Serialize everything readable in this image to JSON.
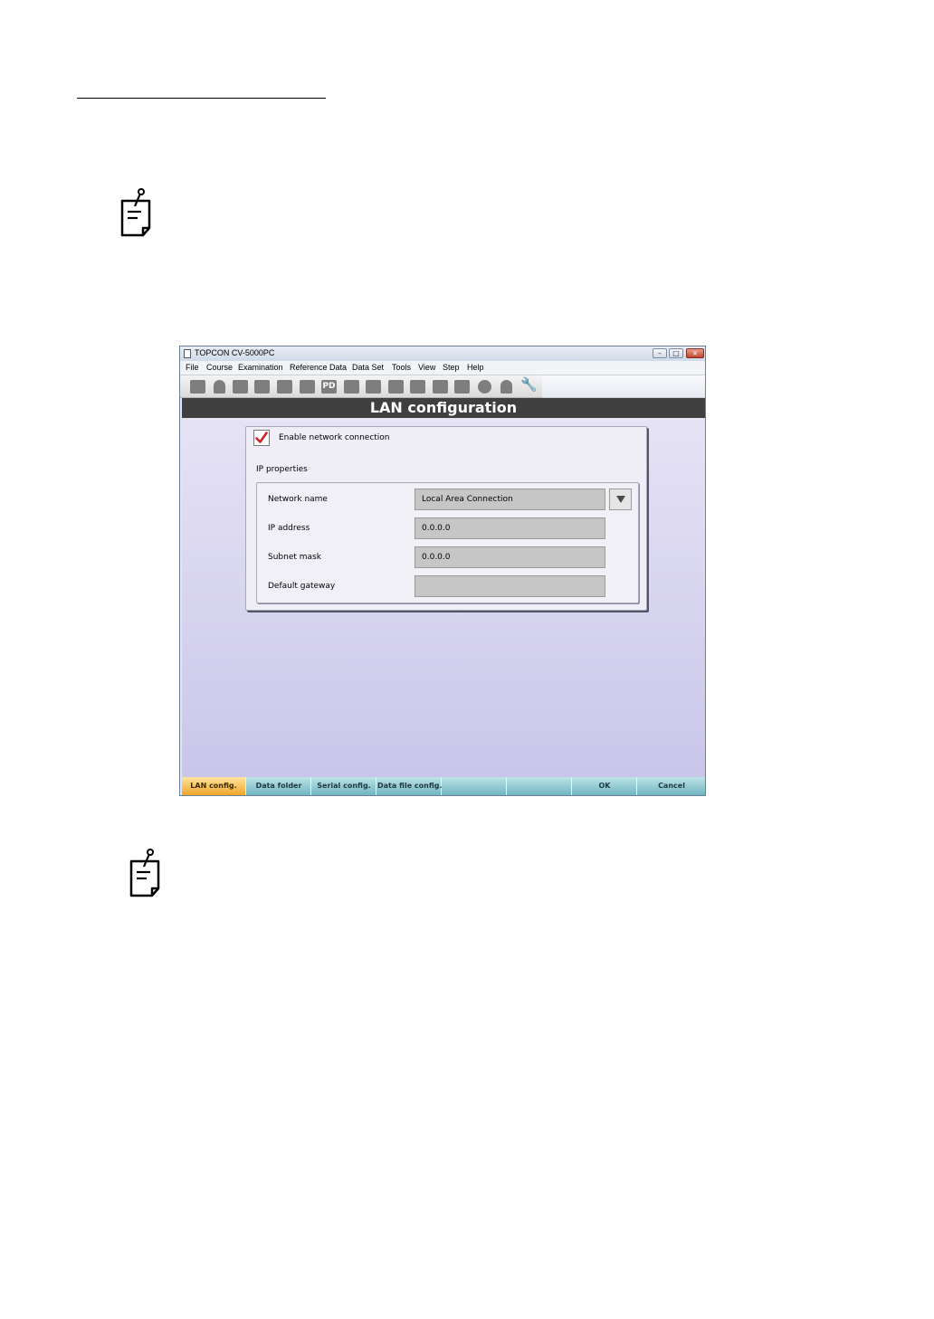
{
  "window": {
    "title": "TOPCON CV-5000PC",
    "controls": {
      "minimize": "–",
      "maximize": "□",
      "close": "×"
    }
  },
  "menu": [
    "File",
    "Course",
    "Examination",
    "Reference Data",
    "Data Set",
    "Tools",
    "View",
    "Step",
    "Help"
  ],
  "toolbar": {
    "pd_label": "PD",
    "icons": [
      "open-icon",
      "patient-icon",
      "lens-icon",
      "lens-pair-icon",
      "keyboard-icon",
      "card-icon",
      "pd-icon",
      "square-icon",
      "chart-icon",
      "pc-icon",
      "speech-icon",
      "monitor-icon",
      "book-icon",
      "circle-icon",
      "person-icon",
      "wrench-icon"
    ]
  },
  "header": {
    "title": "LAN configuration"
  },
  "panel": {
    "enable_label": "Enable network connection",
    "enabled": true,
    "ip_properties_label": "IP properties",
    "fields": [
      {
        "label": "Network name",
        "value": "Local Area Connection"
      },
      {
        "label": "IP address",
        "value": "0.0.0.0"
      },
      {
        "label": "Subnet mask",
        "value": "0.0.0.0"
      },
      {
        "label": "Default gateway",
        "value": ""
      }
    ]
  },
  "bottom_tabs": [
    {
      "label": "LAN config.",
      "active": true
    },
    {
      "label": "Data folder"
    },
    {
      "label": "Serial config."
    },
    {
      "label": "Data file config."
    },
    {
      "label": ""
    },
    {
      "label": ""
    },
    {
      "label": "OK"
    },
    {
      "label": "Cancel"
    }
  ],
  "colors": {
    "header_bg": "#3f3f3f",
    "active_tab": "#f0a52a",
    "tab_bar": "#6fb5c0",
    "check": "#d0202a"
  }
}
